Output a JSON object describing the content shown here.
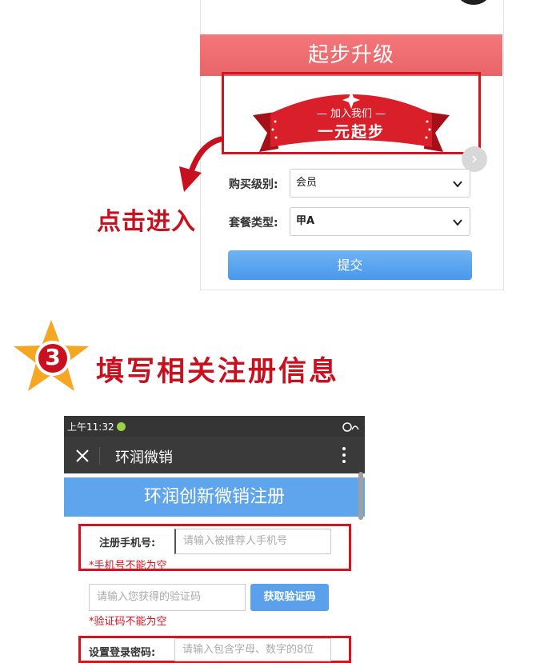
{
  "upgrade": {
    "header_title": "起步升级",
    "banner_line1": "— 加入我们 —",
    "banner_line2": "一元起步",
    "level_label": "购买级别:",
    "level_value": "会员",
    "package_label": "套餐类型:",
    "package_value": "甲A",
    "submit_label": "提交"
  },
  "annotation": {
    "click_text": "点击进入",
    "step_number": "3",
    "step_title": "填写相关注册信息"
  },
  "phone": {
    "status_time": "上午11:32",
    "app_title": "环润微销",
    "page_title": "环润创新微销注册",
    "phone_label": "注册手机号:",
    "phone_placeholder": "请输入被推荐人手机号",
    "phone_error": "*手机号不能为空",
    "code_placeholder": "请输入您获得的验证码",
    "code_button": "获取验证码",
    "code_error": "*验证码不能为空",
    "password_label": "设置登录密码:",
    "password_placeholder": "请输入包含字母、数字的8位"
  },
  "colors": {
    "accent_red": "#c8101e",
    "header_pink": "#f07074",
    "button_blue": "#5ba0ec",
    "star_orange": "#f5a623"
  }
}
